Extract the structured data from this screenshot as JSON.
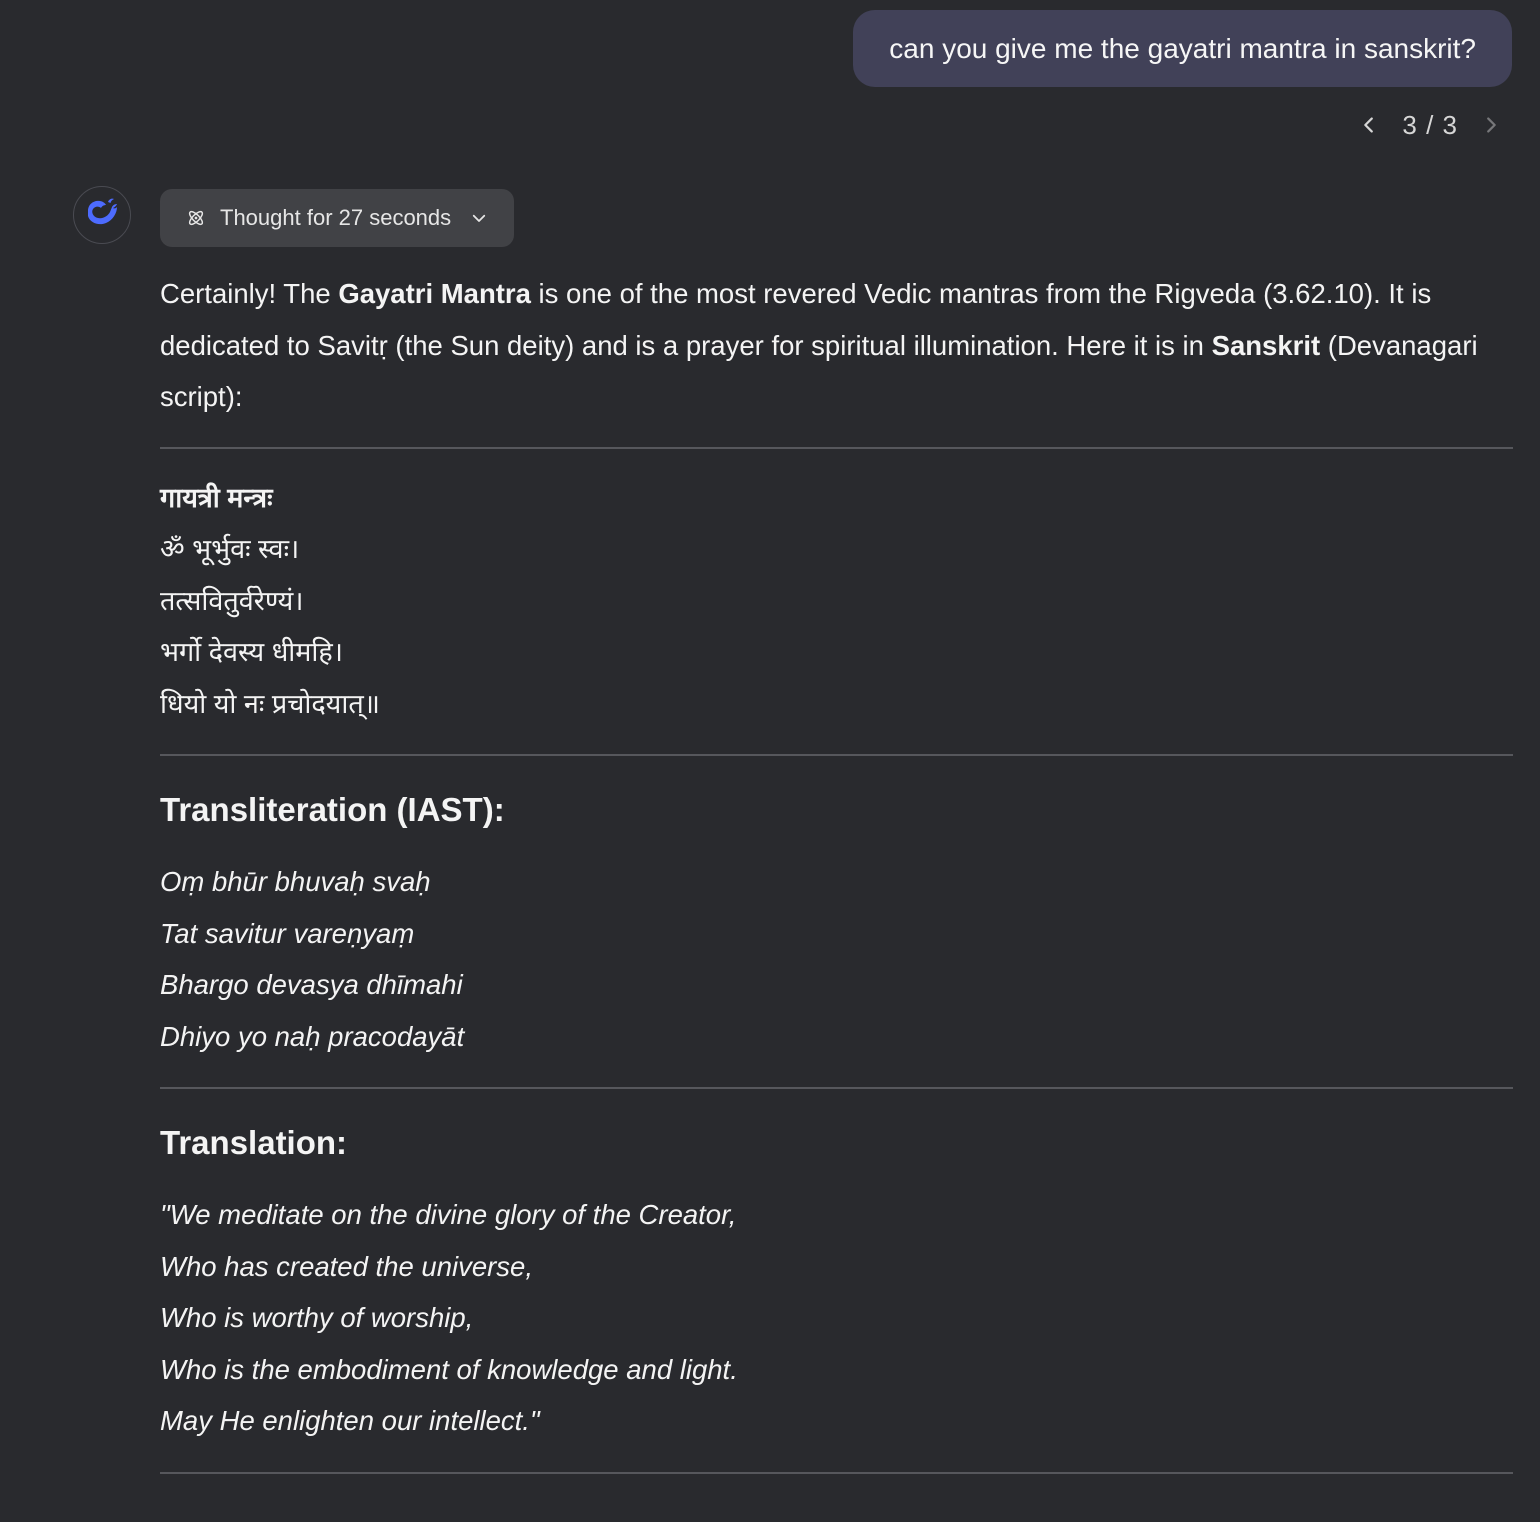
{
  "user_message": {
    "text": "can you give me the gayatri mantra in sanskrit?"
  },
  "pager": {
    "count": "3 / 3",
    "prev_icon": "chevron-left-icon",
    "next_icon": "chevron-right-icon"
  },
  "assistant": {
    "avatar_icon": "deepseek-whale-logo-icon",
    "thought_label": "Thought for 27 seconds",
    "thought_icon": "atom-icon",
    "expand_icon": "chevron-down-icon",
    "intro": {
      "part1": "Certainly! The ",
      "bold1": "Gayatri Mantra",
      "part2": " is one of the most revered Vedic mantras from the Rigveda (3.62.10). It is dedicated to Savitṛ (the Sun deity) and is a prayer for spiritual illumination. Here it is in ",
      "bold2": "Sanskrit",
      "part3": " (Devanagari script):"
    },
    "sanskrit": {
      "title": "गायत्री मन्त्रः",
      "lines": [
        "ॐ भूर्भुवः स्वः।",
        "तत्सवितुर्वरेण्यं।",
        "भर्गो देवस्य धीमहि।",
        "धियो यो नः प्रचोदयात्॥"
      ]
    },
    "transliteration": {
      "heading": "Transliteration (IAST):",
      "lines": [
        "Oṃ bhūr bhuvaḥ svaḥ",
        "Tat savitur vareṇyaṃ",
        "Bhargo devasya dhīmahi",
        "Dhiyo yo naḥ pracodayāt"
      ]
    },
    "translation": {
      "heading": "Translation:",
      "lines": [
        "\"We meditate on the divine glory of the Creator,",
        "Who has created the universe,",
        "Who is worthy of worship,",
        "Who is the embodiment of knowledge and light.",
        "May He enlighten our intellect.\""
      ]
    }
  },
  "colors": {
    "background": "#292a2e",
    "user_bubble": "#414158",
    "thought_button": "#414246",
    "divider": "#56575c",
    "logo_blue": "#4d6bfe"
  }
}
